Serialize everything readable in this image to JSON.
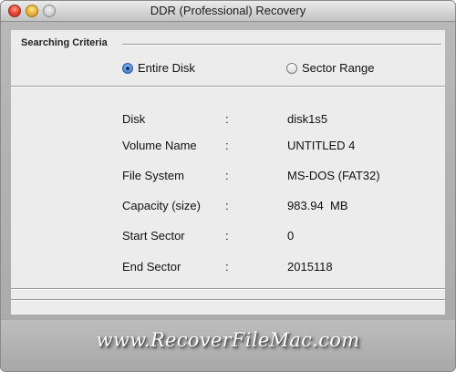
{
  "window": {
    "title": "DDR (Professional) Recovery"
  },
  "criteria": {
    "label": "Searching Criteria",
    "options": [
      {
        "label": "Entire Disk",
        "selected": true
      },
      {
        "label": "Sector Range",
        "selected": false
      }
    ]
  },
  "info": {
    "separator": ":",
    "rows": [
      {
        "label": "Disk",
        "value": "disk1s5"
      },
      {
        "label": "Volume Name",
        "value": "UNTITLED 4"
      },
      {
        "label": "File System",
        "value": "MS-DOS (FAT32)"
      },
      {
        "label": "Capacity (size)",
        "value": "983.94  MB"
      },
      {
        "label": "Start Sector",
        "value": "0"
      },
      {
        "label": "End Sector",
        "value": "2015118"
      }
    ]
  },
  "footer": {
    "brand": "www.RecoverFileMac.com"
  }
}
